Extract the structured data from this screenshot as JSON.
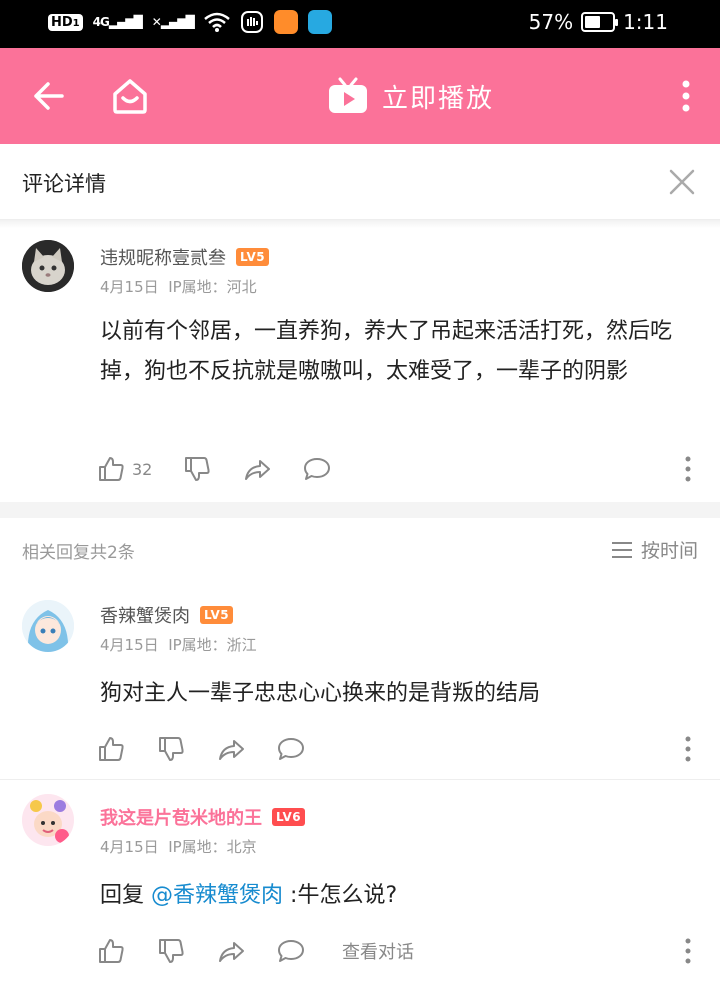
{
  "status_bar": {
    "network_badge": "HD",
    "network_sub": "1",
    "signal_label": "4G",
    "battery_text": "57%",
    "battery_level": 0.57,
    "time": "1:11"
  },
  "app_bar": {
    "play_label": "立即播放"
  },
  "detail_header": {
    "title": "评论详情"
  },
  "main_comment": {
    "username": "违规昵称壹贰叁",
    "level": "LV5",
    "level_color": "#ff8c3a",
    "date": "4月15日",
    "ip": "IP属地：河北",
    "text": "以前有个邻居，一直养狗，养大了吊起来活活打死，然后吃掉，狗也不反抗就是嗷嗷叫，太难受了，一辈子的阴影",
    "like_count": "32"
  },
  "replies_bar": {
    "count_label": "相关回复共2条",
    "sort_label": "按时间"
  },
  "replies": [
    {
      "username": "香辣蟹煲肉",
      "level": "LV5",
      "level_color": "#ff8c3a",
      "date": "4月15日",
      "ip": "IP属地：浙江",
      "text": "狗对主人一辈子忠忠心心换来的是背叛的结局"
    },
    {
      "username": "我这是片苞米地的王",
      "level": "LV6",
      "level_color": "#ff4d4f",
      "date": "4月15日",
      "ip": "IP属地：北京",
      "reply_prefix": "回复",
      "mention": "@香辣蟹煲肉",
      "text": ":牛怎么说?",
      "view_chat_label": "查看对话"
    }
  ],
  "colors": {
    "brand_pink": "#fb7299",
    "mention_blue": "#178bcf"
  }
}
